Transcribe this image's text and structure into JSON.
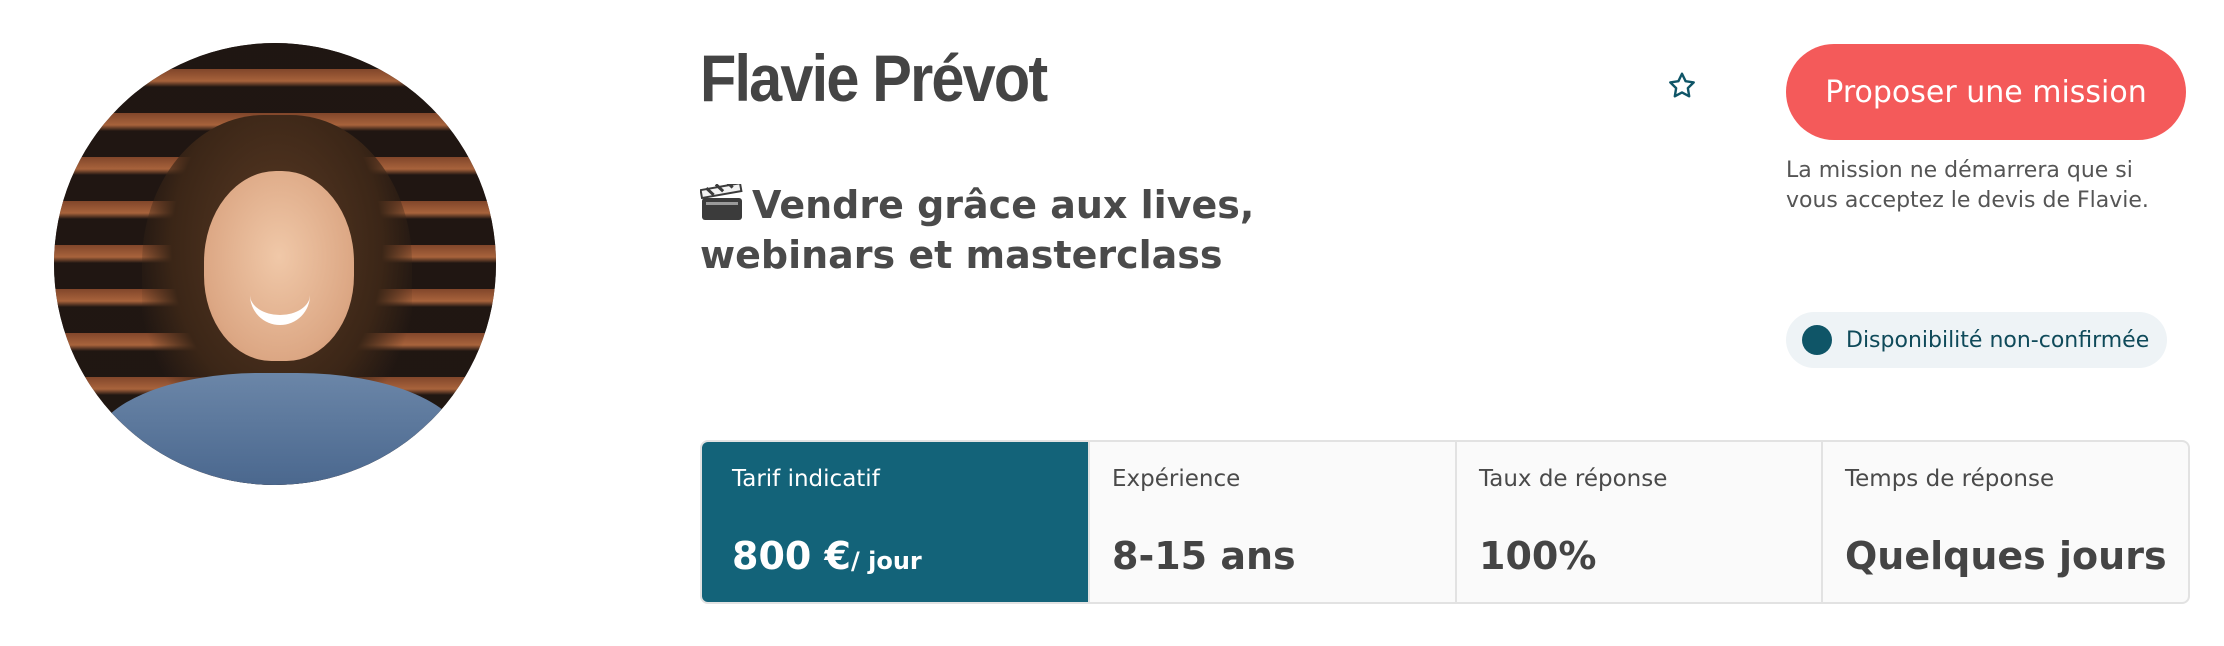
{
  "profile": {
    "name": "Flavie Prévot",
    "headline": "Vendre grâce aux lives, webinars et masterclass",
    "headline_icon": "clapperboard-icon"
  },
  "actions": {
    "favorite_icon": "star-outline-icon",
    "cta_label": "Proposer une mission",
    "cta_note": "La mission ne démarrera que si vous acceptez le devis de Flavie.",
    "availability": "Disponibilité non-confirmée"
  },
  "stats": [
    {
      "label": "Tarif indicatif",
      "value": "800 €",
      "unit": "/ jour"
    },
    {
      "label": "Expérience",
      "value": "8-15 ans"
    },
    {
      "label": "Taux de réponse",
      "value": "100%"
    },
    {
      "label": "Temps de réponse",
      "value": "Quelques jours"
    }
  ],
  "colors": {
    "cta": "#f45a5a",
    "accent": "#136379",
    "availability_dot": "#0f5567",
    "star": "#0f5567"
  }
}
